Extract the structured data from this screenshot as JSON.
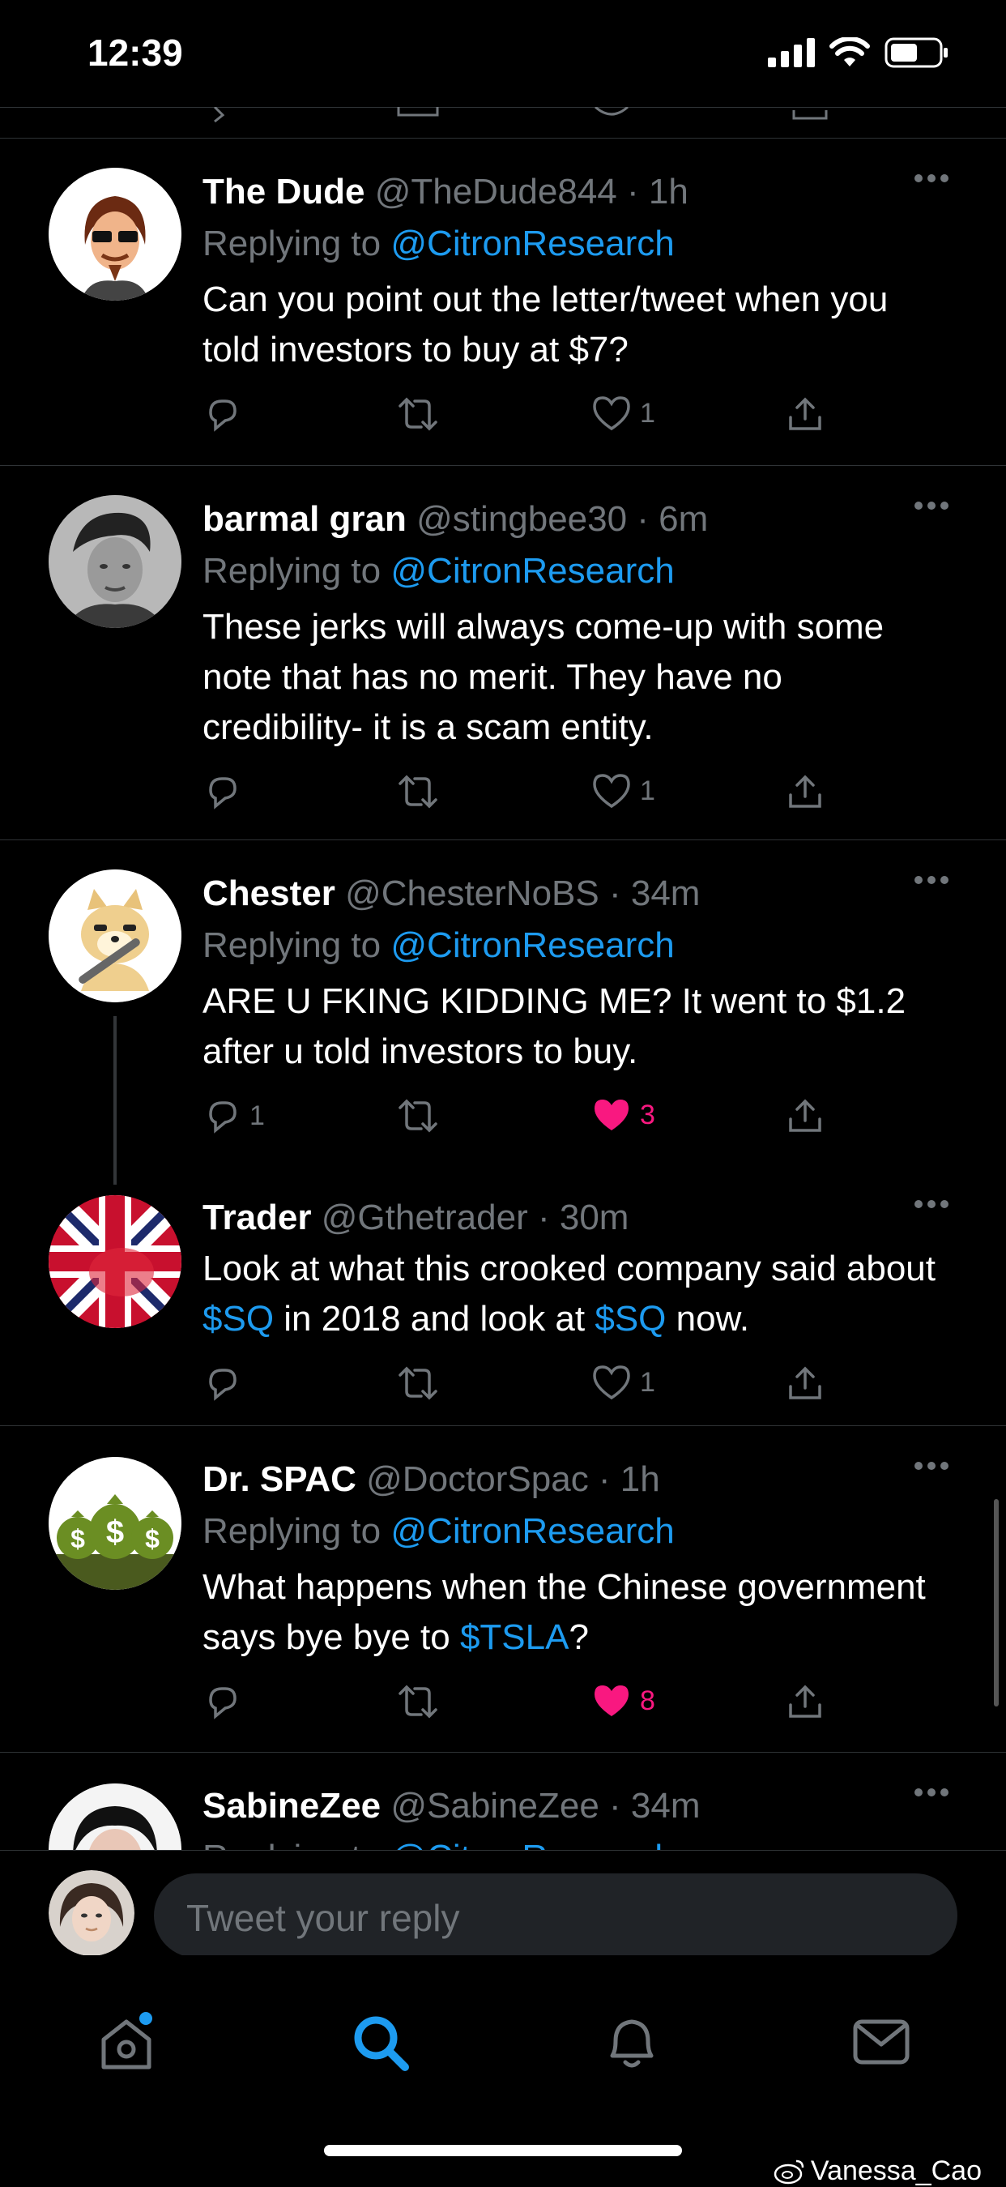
{
  "status": {
    "time": "12:39"
  },
  "tweets": [
    {
      "name": "The Dude",
      "handle": "@TheDude844 · 1h",
      "reply_prefix": "Replying to",
      "reply_to": "@CitronResearch",
      "body": "Can you point out the letter/tweet when you told investors to buy at $7?",
      "replies": "",
      "likes": "1",
      "liked": false
    },
    {
      "name": "barmal gran",
      "handle": "@stingbee30 · 6m",
      "reply_prefix": "Replying to",
      "reply_to": "@CitronResearch",
      "body": "These jerks will always come-up with some note that has no merit. They have no credibility- it is a scam entity.",
      "replies": "",
      "likes": "1",
      "liked": false
    },
    {
      "name": "Chester",
      "handle": "@ChesterNoBS · 34m",
      "reply_prefix": "Replying to",
      "reply_to": "@CitronResearch",
      "body": "ARE U FKING KIDDING ME? It went to $1.2 after u told investors to buy.",
      "replies": "1",
      "likes": "3",
      "liked": true
    },
    {
      "name": "Trader",
      "handle": "@Gthetrader · 30m",
      "body_parts": [
        "Look at what this crooked company said about ",
        "$SQ",
        " in 2018 and look at ",
        "$SQ",
        " now."
      ],
      "replies": "",
      "likes": "1",
      "liked": false
    },
    {
      "name": "Dr. SPAC",
      "handle": "@DoctorSpac · 1h",
      "reply_prefix": "Replying to",
      "reply_to": "@CitronResearch",
      "body_parts": [
        "What happens when the Chinese government says bye bye to ",
        "$TSLA",
        "?"
      ],
      "replies": "",
      "likes": "8",
      "liked": true
    },
    {
      "name": "SabineZee",
      "handle": "@SabineZee · 34m",
      "reply_prefix": "Replying to",
      "reply_to": "@CitronResearch"
    }
  ],
  "composer": {
    "placeholder": "Tweet your reply"
  },
  "tabs": [
    "home",
    "search",
    "notifications",
    "messages"
  ],
  "watermark": "Vanessa_Cao",
  "colors": {
    "accent": "#1d9bf0",
    "like": "#f91880",
    "muted": "#71767b"
  }
}
